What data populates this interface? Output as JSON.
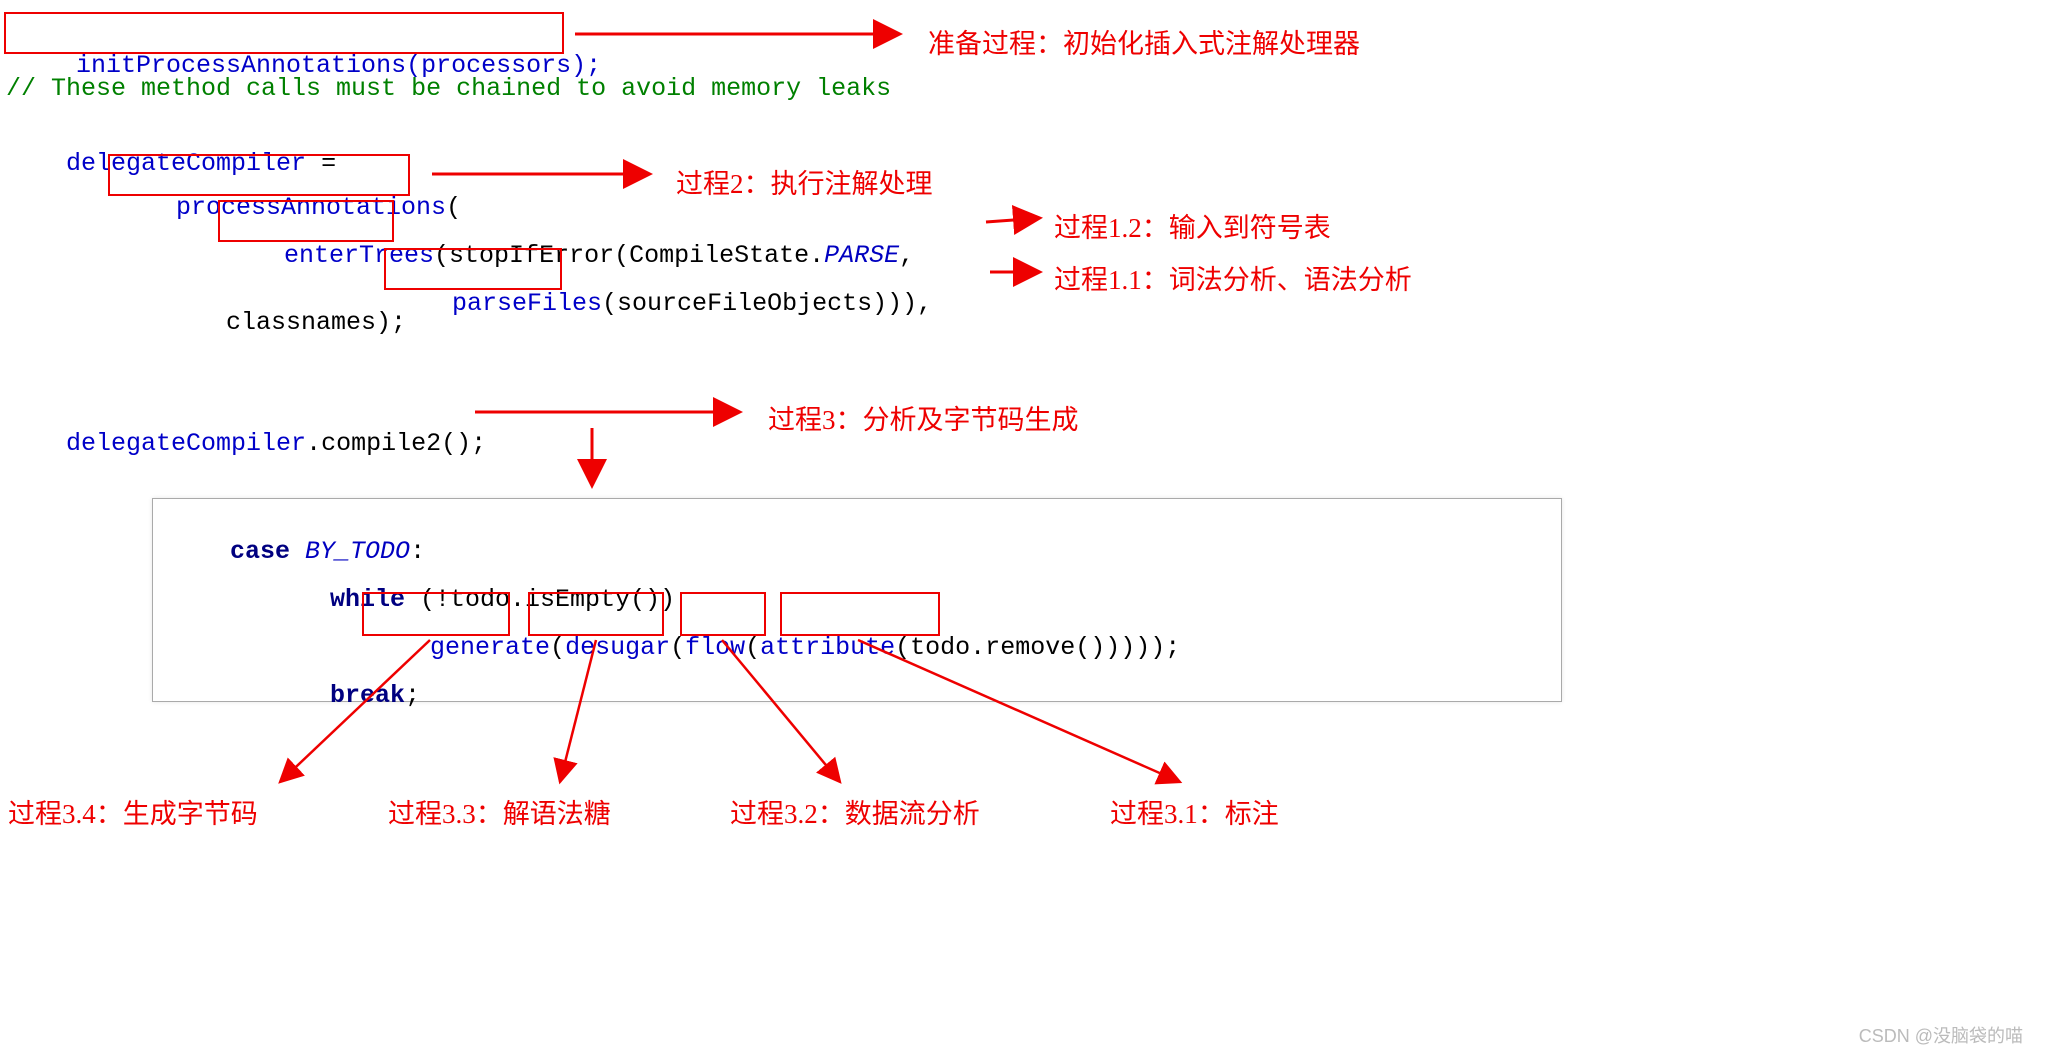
{
  "code": {
    "line1a": "initProcessAnnotations",
    "line1b": "(processors);",
    "line2": "// These method calls must be chained to avoid memory leaks",
    "line3a": "delegateCompiler",
    "line3b": " =",
    "line4a": "processAnnotations",
    "line4b": "(",
    "line5a": "enterTrees",
    "line5b": "(stopIfError(CompileState.",
    "line5c": "PARSE",
    "line5d": ",",
    "line6a": "parseFiles",
    "line6b": "(sourceFileObjects))),",
    "line7": "classnames);",
    "line8a": "delegateCompiler",
    "line8b": ".compile2();",
    "block_case": "case",
    "block_by_todo": " BY_TODO",
    "block_colon": ":",
    "block_while": "while",
    "block_while_cond": " (!todo.isEmpty())",
    "block_gen": "generate",
    "block_open1": "(",
    "block_desugar": "desugar",
    "block_open2": "(",
    "block_flow": "flow",
    "block_open3": "(",
    "block_attr": "attribute",
    "block_tail": "(todo.remove()))));",
    "block_break": "break",
    "block_semi": ";"
  },
  "anno": {
    "prep": "准备过程：初始化插入式注解处理器",
    "p2": "过程2：执行注解处理",
    "p12": "过程1.2：输入到符号表",
    "p11": "过程1.1：词法分析、语法分析",
    "p3": "过程3：分析及字节码生成",
    "p34": "过程3.4：生成字节码",
    "p33": "过程3.3：解语法糖",
    "p32": "过程3.2：数据流分析",
    "p31": "过程3.1：标注"
  },
  "watermark": "CSDN @没脑袋的喵"
}
